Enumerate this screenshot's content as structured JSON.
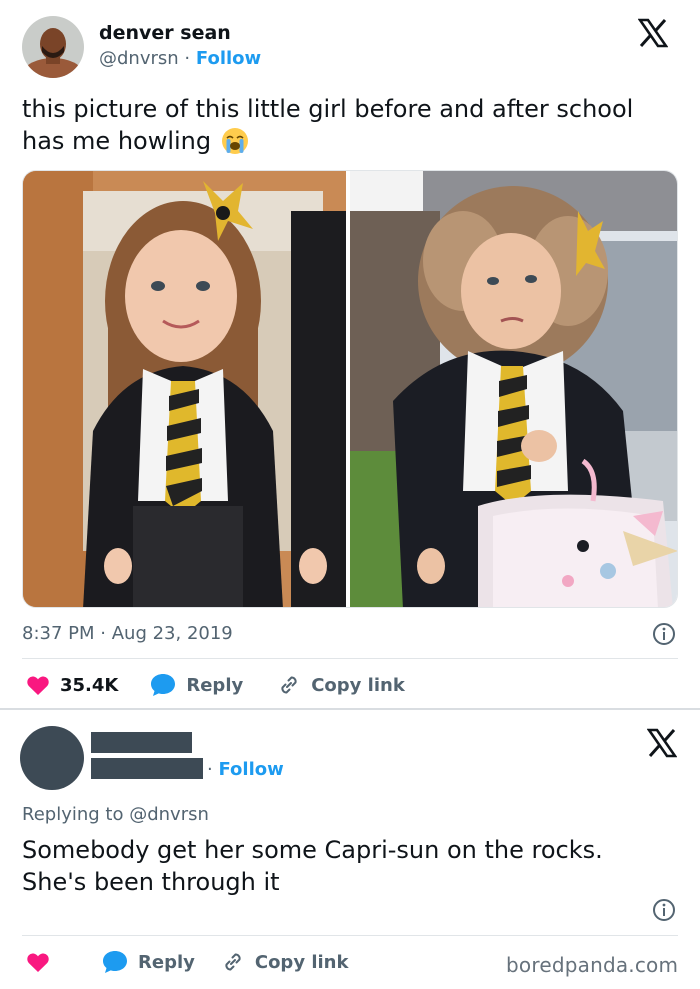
{
  "tweet": {
    "author_name": "denver sean",
    "handle": "@dnvrsn",
    "dot": "·",
    "follow_label": "Follow",
    "text_line1": "this picture of this little girl before and after school",
    "text_line2": "has me howling",
    "emoji": "😭",
    "time": "8:37 PM",
    "date": "Aug 23, 2019",
    "likes": "35.4K",
    "reply_label": "Reply",
    "copy_link_label": "Copy link"
  },
  "reply": {
    "follow_label": "Follow",
    "dot": "·",
    "replying_to_prefix": "Replying to",
    "replying_to_handle": "@dnvrsn",
    "text_line1": "Somebody get her some Capri-sun on the rocks.",
    "text_line2": "She's been through it",
    "reply_label": "Reply",
    "copy_link_label": "Copy link"
  },
  "watermark": "boredpanda.com",
  "colors": {
    "accent": "#1d9bf0",
    "like": "#f91880",
    "muted": "#536471",
    "text": "#0f1419",
    "redaction": "#3d4a55"
  },
  "icons": [
    "x-logo-icon",
    "heart-icon",
    "speech-bubble-icon",
    "link-icon",
    "info-icon"
  ]
}
